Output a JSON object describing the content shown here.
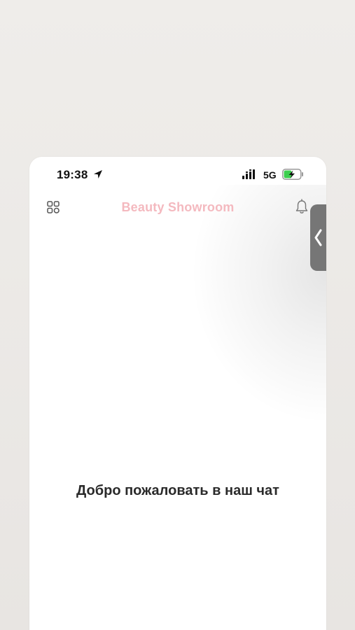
{
  "status_bar": {
    "time": "19:38",
    "network": "5G",
    "icons": {
      "location": "location-arrow-icon",
      "signal": "signal-strength-icon",
      "battery": "battery-charging-icon"
    }
  },
  "header": {
    "title": "Beauty Showroom",
    "left_icon": "grid-icon",
    "right_icon": "bell-icon"
  },
  "side_panel": {
    "icon": "chevron-left-icon"
  },
  "chat": {
    "welcome_text": "Добро пожаловать в наш чат"
  },
  "colors": {
    "title": "#f4b9bf",
    "background": "#ffffff",
    "page_background": "#e9e6e3",
    "handle": "#767676",
    "battery_green": "#3ccf4e"
  }
}
